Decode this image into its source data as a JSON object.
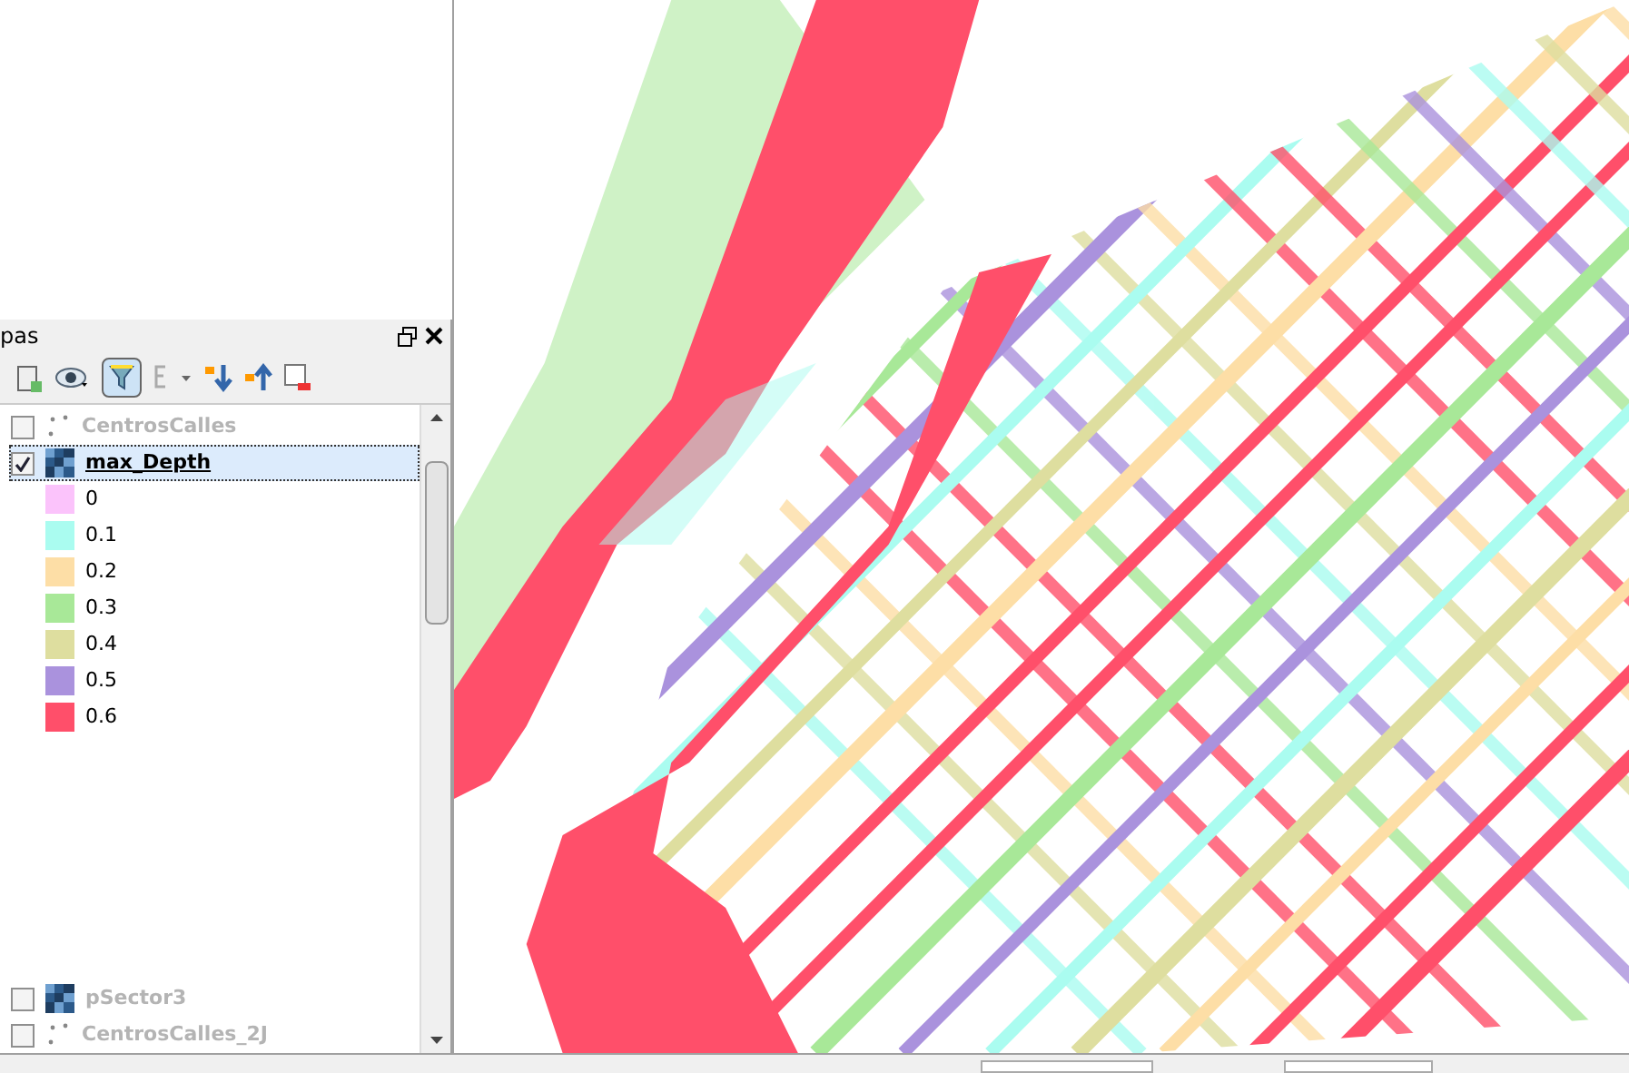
{
  "panel": {
    "title": "pas"
  },
  "layers": [
    {
      "name": "CentrosCalles",
      "kind": "points",
      "checked": false,
      "selected": false
    },
    {
      "name": "max_Depth",
      "kind": "raster",
      "checked": true,
      "selected": true,
      "children": [
        {
          "label": "0",
          "color": "#fbc3fb"
        },
        {
          "label": "0.1",
          "color": "#aafcf0"
        },
        {
          "label": "0.2",
          "color": "#fddea6"
        },
        {
          "label": "0.3",
          "color": "#a8e898"
        },
        {
          "label": "0.4",
          "color": "#dede9f"
        },
        {
          "label": "0.5",
          "color": "#aa92dd"
        },
        {
          "label": "0.6",
          "color": "#ff4f6a"
        }
      ]
    },
    {
      "name": "pSector3",
      "kind": "raster",
      "checked": false,
      "selected": false
    },
    {
      "name": "CentrosCalles_2J",
      "kind": "points",
      "checked": false,
      "selected": false
    }
  ]
}
